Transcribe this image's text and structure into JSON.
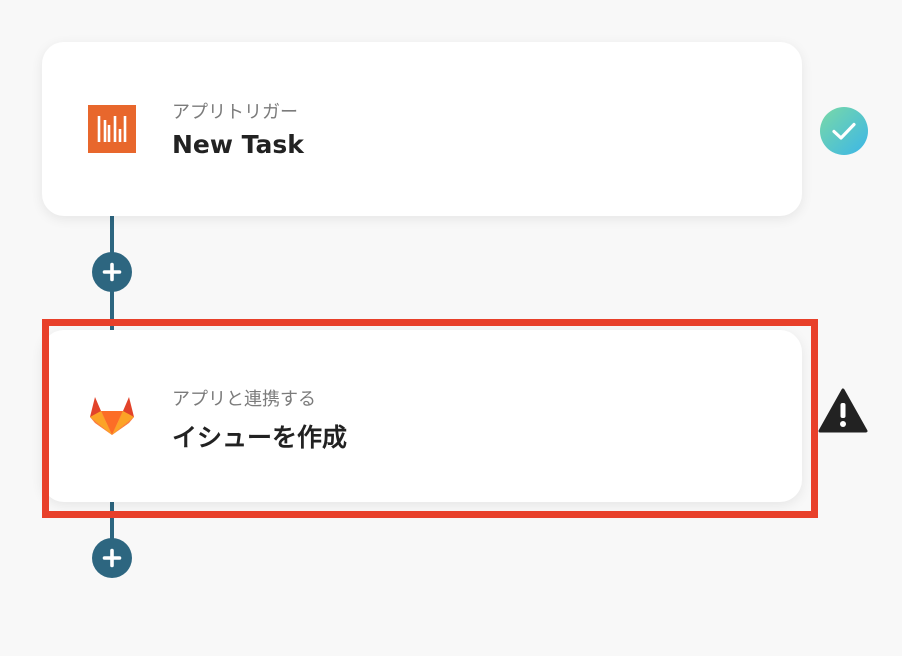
{
  "flow": {
    "steps": [
      {
        "subtitle": "アプリトリガー",
        "title": "New Task",
        "app_icon": "flowing-app-icon",
        "status": "completed",
        "status_icon": "check-circle-icon",
        "status_color": "#46bde0",
        "icon_color": "#e8672c"
      },
      {
        "subtitle": "アプリと連携する",
        "title": "イシューを作成",
        "app_icon": "gitlab-icon",
        "status": "warning",
        "status_icon": "warning-triangle-icon",
        "status_color": "#222222",
        "highlighted": true
      }
    ],
    "add_step_icon": "plus-icon",
    "connector_color": "#2d6680",
    "highlight_color": "#e8402a"
  }
}
